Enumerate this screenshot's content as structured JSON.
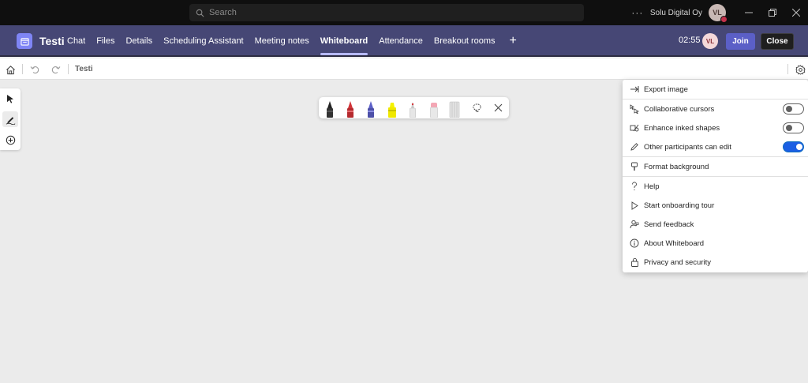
{
  "titlebar": {
    "search_placeholder": "Search",
    "more": "···",
    "org": "Solu Digital Oy",
    "avatar_initials": "VL"
  },
  "meeting": {
    "title": "Testi",
    "tabs": [
      {
        "label": "Chat"
      },
      {
        "label": "Files"
      },
      {
        "label": "Details"
      },
      {
        "label": "Scheduling Assistant"
      },
      {
        "label": "Meeting notes"
      },
      {
        "label": "Whiteboard",
        "active": true
      },
      {
        "label": "Attendance"
      },
      {
        "label": "Breakout rooms"
      }
    ],
    "timer": "02:55",
    "avatar_initials": "VL",
    "join_label": "Join",
    "close_label": "Close"
  },
  "whiteboard": {
    "name": "Testi"
  },
  "pens": [
    {
      "name": "black-pen",
      "color": "#222222"
    },
    {
      "name": "red-pen",
      "color": "#d13438"
    },
    {
      "name": "blue-pen",
      "color": "#5b5fc7"
    },
    {
      "name": "highlighter",
      "color": "#f5f200"
    },
    {
      "name": "laser-pointer",
      "color": "#e8e8e8"
    },
    {
      "name": "eraser",
      "color": "#f4a6b4"
    },
    {
      "name": "ruler",
      "color": "#dcdcdc"
    }
  ],
  "settings_menu": {
    "items": [
      {
        "label": "Export image",
        "icon": "export-icon"
      },
      {
        "label": "Collaborative cursors",
        "icon": "cursors-icon",
        "toggle": false
      },
      {
        "label": "Enhance inked shapes",
        "icon": "shapes-icon",
        "toggle": false
      },
      {
        "label": "Other participants can edit",
        "icon": "pencil-icon",
        "toggle": true
      },
      {
        "label": "Format background",
        "icon": "brush-icon"
      },
      {
        "label": "Help",
        "icon": "help-icon"
      },
      {
        "label": "Start onboarding tour",
        "icon": "play-icon"
      },
      {
        "label": "Send feedback",
        "icon": "feedback-icon"
      },
      {
        "label": "About Whiteboard",
        "icon": "info-icon"
      },
      {
        "label": "Privacy and security",
        "icon": "lock-icon"
      }
    ]
  }
}
